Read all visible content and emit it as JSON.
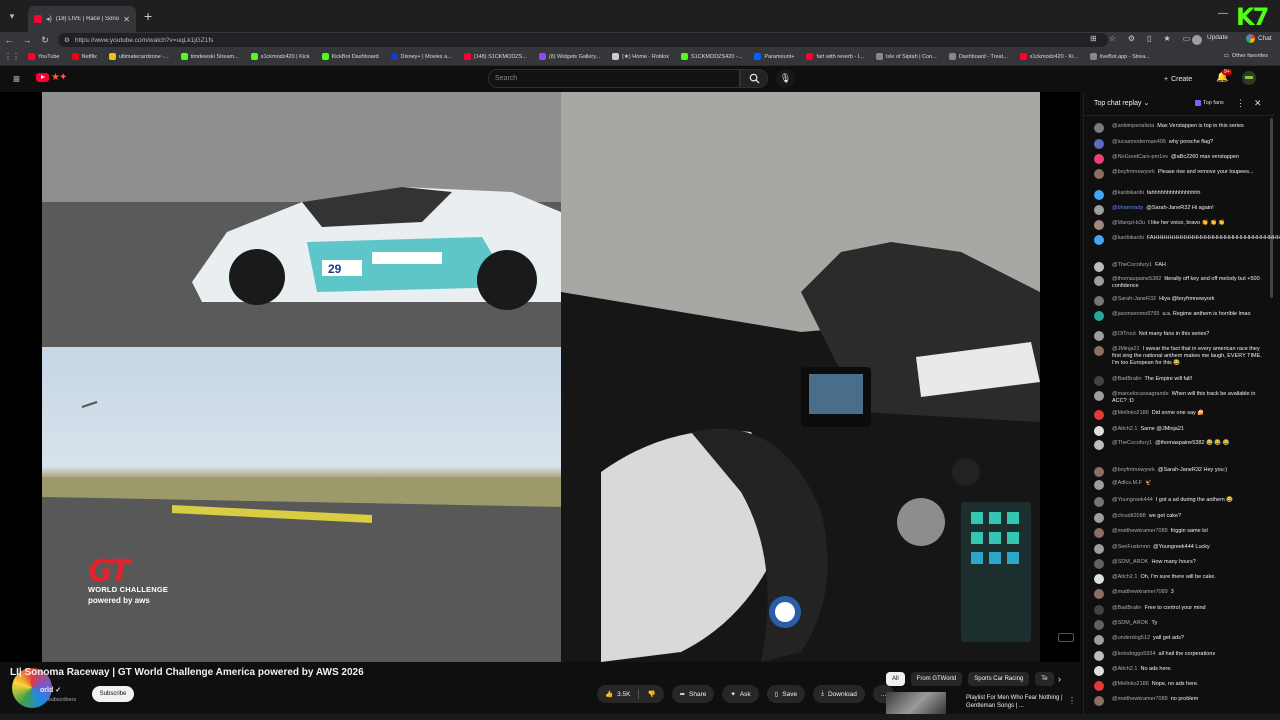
{
  "browser": {
    "tab_title": "(18) LIVE | Race | Sonoma Ra...",
    "url": "https://www.youtube.com/watch?v=uqLk1jGZ1fs",
    "update_label": "Update",
    "chat_label": "Chat",
    "other_favorites": "Other favorites",
    "bookmarks": [
      {
        "label": "YouTube",
        "color": "#ff0033"
      },
      {
        "label": "Netflix",
        "color": "#e50914"
      },
      {
        "label": "ultimatecardzone -...",
        "color": "#f4c20d"
      },
      {
        "label": "timdewski Stream...",
        "color": "#53fc18"
      },
      {
        "label": "s1ckmodz420 | Kick",
        "color": "#53fc18"
      },
      {
        "label": "KickBot Dashboard",
        "color": "#53fc18"
      },
      {
        "label": "Disney+ | Movies a...",
        "color": "#113ccf"
      },
      {
        "label": "(148) S1CKMODZS...",
        "color": "#ff0033"
      },
      {
        "label": "(8) Widgets Gallery...",
        "color": "#9146ff"
      },
      {
        "label": "(★) Home - Roblox",
        "color": "#cccccc"
      },
      {
        "label": "S1CKMODZS420 -...",
        "color": "#53fc18"
      },
      {
        "label": "Paramount+",
        "color": "#0064ff"
      },
      {
        "label": "fart with reverb - I...",
        "color": "#ff0033"
      },
      {
        "label": "Isle of Siptah | Con...",
        "color": "#888888"
      },
      {
        "label": "Dashboard - Treat...",
        "color": "#888888"
      },
      {
        "label": "s1ckmodz420 - Ki...",
        "color": "#ff0033"
      },
      {
        "label": "liveBot.app - Strea...",
        "color": "#888888"
      }
    ]
  },
  "youtube": {
    "search_placeholder": "Search",
    "create_label": "Create",
    "notif_count": "9+"
  },
  "video": {
    "title_prefix": "LI",
    "title": "| Sonoma Raceway | GT World Challenge America powered by AWS 2026",
    "channel": "orld",
    "subscribers": "subscribers",
    "subscribe_label": "Subscribe",
    "logo_mark": "GT",
    "logo_line1": "WORLD CHALLENGE",
    "logo_line2": "powered by aws",
    "car_number": "29"
  },
  "actions": {
    "likes": "3.5K",
    "share": "Share",
    "ask": "Ask",
    "save": "Save",
    "download": "Download",
    "more": "..."
  },
  "chips": [
    "All",
    "From GTWorld",
    "Sports Car Racing",
    "Te"
  ],
  "recommendation": {
    "title": "Playlist For Men Who Fear Nothing | Gentleman Songs | ..."
  },
  "chat": {
    "mode": "Top chat replay",
    "top_fans": "Top fans",
    "messages": [
      {
        "user": "@antiimperialista",
        "text": "Max Verstappen is top in this series",
        "color": "#7a7a7a"
      },
      {
        "user": "@lucasmoderman406",
        "text": "why porsche flag?",
        "color": "#5c6bc0"
      },
      {
        "user": "@NoGoodCars-pm1ev",
        "text": "@aBc2260 max verstappen",
        "color": "#ec407a"
      },
      {
        "user": "@boyfrmnewyork",
        "text": "Please rise and remove your toupees...",
        "color": "#8d6e63"
      },
      {
        "user": "@karibikaribi",
        "text": "fahhhhhhhhhhhhhhhh",
        "color": "#42a5f5"
      },
      {
        "user": "@bhamirady",
        "text": "@Sarah-JaneR32 Hi again!",
        "color": "#9e9e9e",
        "blue": true
      },
      {
        "user": "@Marqzi-b3u",
        "text": "I like her voice, bravo 👏 👏 👏",
        "color": "#a1887f"
      },
      {
        "user": "@karibikaribi",
        "text": "FAHHHHHHHHHHHHHHHHHHHHHHHHHHHHHHHHHHHHHHHHHHHHHHHH",
        "color": "#42a5f5"
      },
      {
        "user": "@TheCocofury1",
        "text": "FAH",
        "color": "#bdbdbd"
      },
      {
        "user": "@thomaspaine5382",
        "text": "literally off key and off melody but +500 confidence",
        "color": "#9e9e9e"
      },
      {
        "user": "@Sarah-JaneR32",
        "text": "Hiya @boyfrmnewyork",
        "color": "#757575"
      },
      {
        "user": "@jasonsenmo8765",
        "text": "u.s. Regime anthem is horrible lmao",
        "color": "#26a69a"
      },
      {
        "user": "@OlTrout",
        "text": "Not many fans in this series?",
        "color": "#9e9e9e"
      },
      {
        "user": "@JMinja21",
        "text": "I swear the fact that in every american race they first sing the national anthem makes me laugh, EVERY TIME. I'm too European for this 😂",
        "color": "#8d6e63"
      },
      {
        "user": "@BadBralin",
        "text": "The Empire will fall!",
        "color": "#424242"
      },
      {
        "user": "@marcelocassagrande",
        "text": "When will this track be available in ACC? :D",
        "color": "#9e9e9e"
      },
      {
        "user": "@Mellnko2186",
        "text": "Did some one say 🍰",
        "color": "#e53935"
      },
      {
        "user": "@Altch2.1",
        "text": "Same @JMinja21",
        "color": "#e0e0e0"
      },
      {
        "user": "@TheCocofury1",
        "text": "@thomaspaine5382 😂 😂 😂",
        "color": "#bdbdbd"
      },
      {
        "user": "@boyfrmnewyork",
        "text": "@Sarah-JaneR32 Hey you:)",
        "color": "#8d6e63"
      },
      {
        "user": "@Adlcs.M.F",
        "text": "🦅",
        "color": "#9e9e9e"
      },
      {
        "user": "@Youngreek444",
        "text": "I got a ad during the anthem 😂",
        "color": "#757575"
      },
      {
        "user": "@cloudit2088",
        "text": "we get cake?",
        "color": "#9e9e9e"
      },
      {
        "user": "@matthewkramer7089",
        "text": "friggin same lol",
        "color": "#8d6e63"
      },
      {
        "user": "@SeeFuskmnn",
        "text": "@Youngreek444 Lucky",
        "color": "#9e9e9e"
      },
      {
        "user": "@SDM_AROK",
        "text": "How many hours?",
        "color": "#616161"
      },
      {
        "user": "@Altch2.1",
        "text": "Oh, I'm sure there will be cake.",
        "color": "#e0e0e0"
      },
      {
        "user": "@matthewkramer7089",
        "text": "3",
        "color": "#8d6e63"
      },
      {
        "user": "@BadBralin",
        "text": "Free to control your mind",
        "color": "#424242"
      },
      {
        "user": "@SDM_AROK",
        "text": "Ty",
        "color": "#616161"
      },
      {
        "user": "@underdog512",
        "text": "yall get ads?",
        "color": "#9e9e9e"
      },
      {
        "user": "@kotodoggo5934",
        "text": "all hail the corperations",
        "color": "#bdbdbd"
      },
      {
        "user": "@Altch2.1",
        "text": "No ads here.",
        "color": "#e0e0e0"
      },
      {
        "user": "@Mellnko2186",
        "text": "Nope, no ads here.",
        "color": "#e53935"
      },
      {
        "user": "@matthewkramer7089",
        "text": "no problem",
        "color": "#8d6e63"
      }
    ]
  }
}
